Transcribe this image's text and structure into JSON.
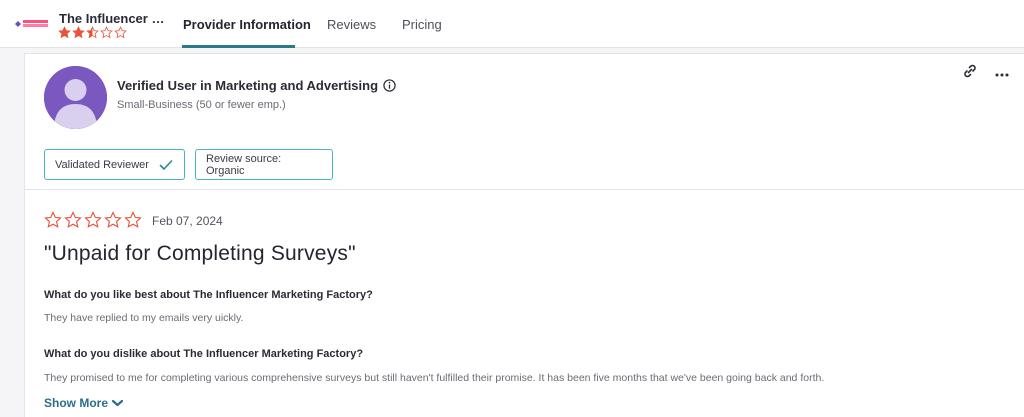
{
  "header": {
    "product_name": "The Influencer Ma...",
    "rating": 2.5,
    "tabs": [
      {
        "label": "Provider Information",
        "active": true
      },
      {
        "label": "Reviews",
        "active": false
      },
      {
        "label": "Pricing",
        "active": false
      }
    ]
  },
  "reviewer": {
    "title": "Verified User in Marketing and Advertising",
    "company_size": "Small-Business (50 or fewer emp.)",
    "badges": [
      {
        "label": "Validated Reviewer",
        "icon": "check-icon"
      },
      {
        "label": "Review source: Organic"
      }
    ]
  },
  "review": {
    "rating": 0,
    "date": "Feb 07, 2024",
    "title": "\"Unpaid for Completing Surveys\"",
    "qa": [
      {
        "question": "What do you like best about The Influencer Marketing Factory?",
        "answer": "They have replied to my emails very uickly."
      },
      {
        "question": "What do you dislike about The Influencer Marketing Factory?",
        "answer": "They promised to me for completing various comprehensive surveys but still haven't fulfilled their promise. It has been five months that we've been going back and forth."
      }
    ],
    "show_more_label": "Show More"
  },
  "colors": {
    "star": "#e8533a",
    "accent": "#2b7a8a",
    "badge_border": "#45b6c0",
    "avatar": "#7a58c0"
  }
}
